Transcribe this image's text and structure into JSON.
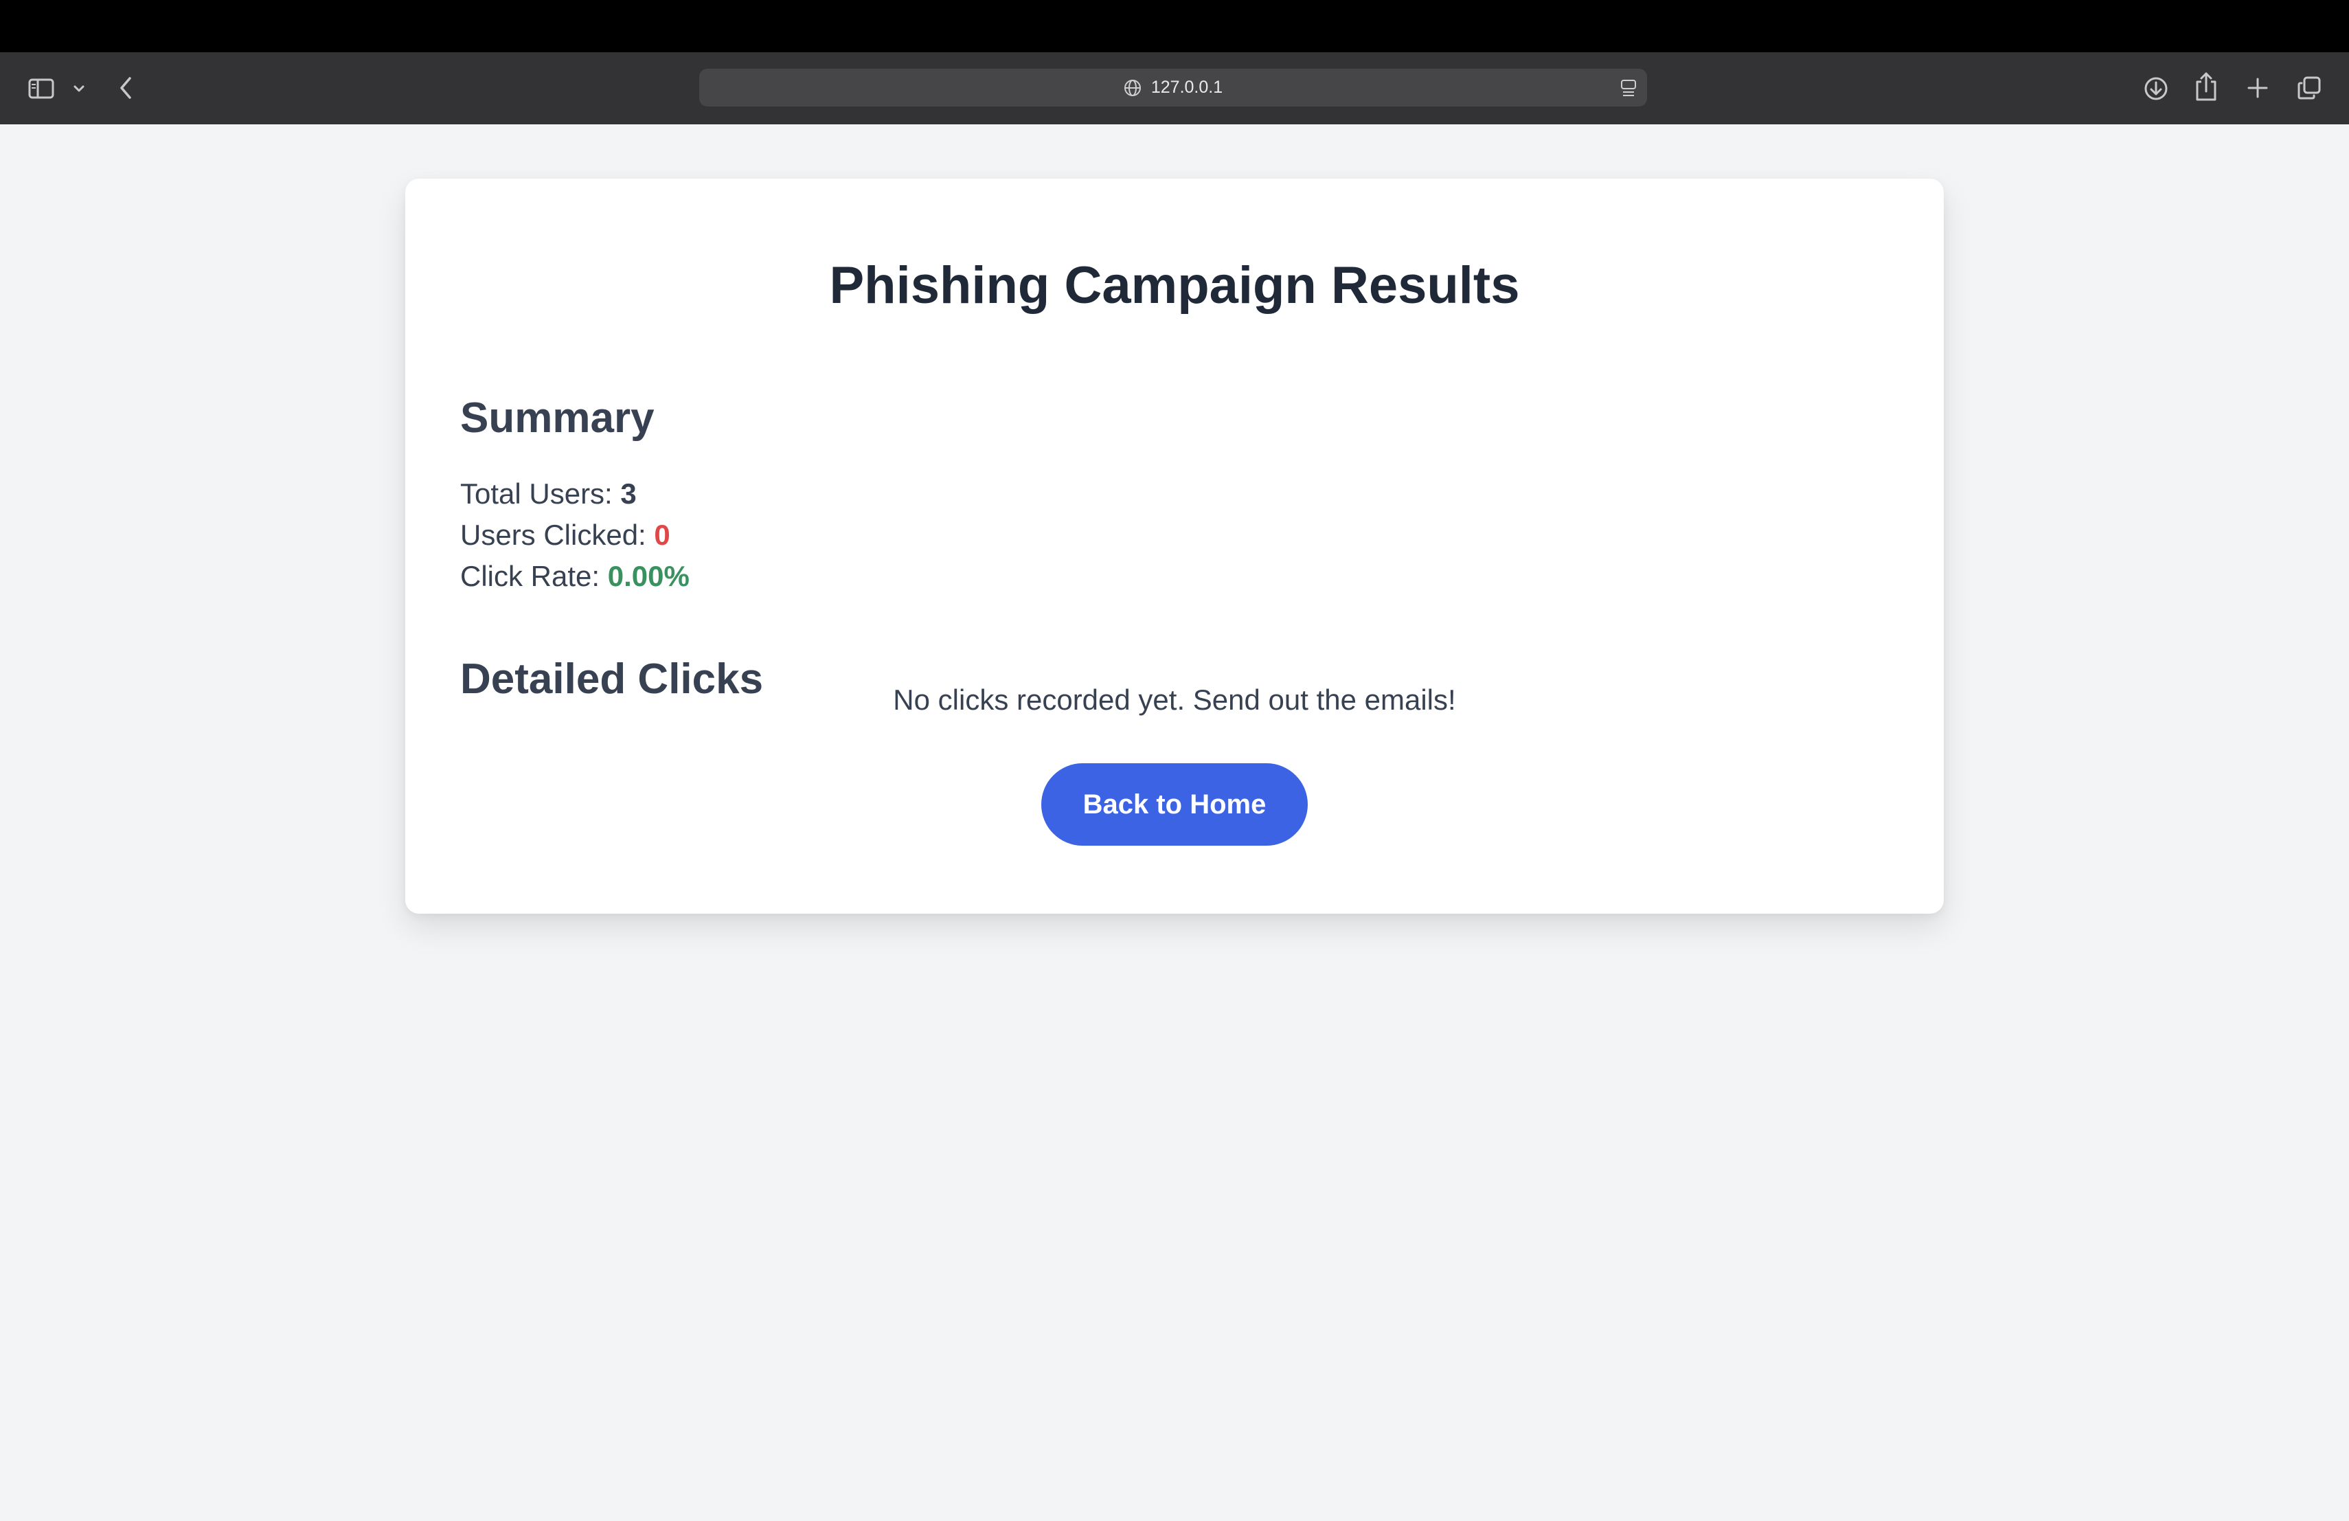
{
  "browser": {
    "url": "127.0.0.1",
    "icons": {
      "sidebar": "sidebar-icon",
      "tab_group_menu": "chevron-down-icon",
      "back": "chevron-left-icon",
      "site": "globe-icon",
      "reader": "reader-icon",
      "download": "download-icon",
      "share": "share-icon",
      "new_tab": "plus-icon",
      "tab_overview": "tabs-icon"
    }
  },
  "page": {
    "title": "Phishing Campaign Results",
    "summary": {
      "heading": "Summary",
      "total_users_label": "Total Users:",
      "total_users_value": "3",
      "users_clicked_label": "Users Clicked:",
      "users_clicked_value": "0",
      "click_rate_label": "Click Rate:",
      "click_rate_value": "0.00%"
    },
    "details": {
      "heading": "Detailed Clicks",
      "empty_message": "No clicks recorded yet. Send out the emails!"
    },
    "back_button_label": "Back to Home"
  },
  "colors": {
    "background": "#f3f4f6",
    "card": "#ffffff",
    "title_text": "#1f2937",
    "body_text": "#374151",
    "clicked_value": "#e04848",
    "click_rate_value": "#38915f",
    "button": "#3b63e4",
    "button_text": "#ffffff"
  }
}
